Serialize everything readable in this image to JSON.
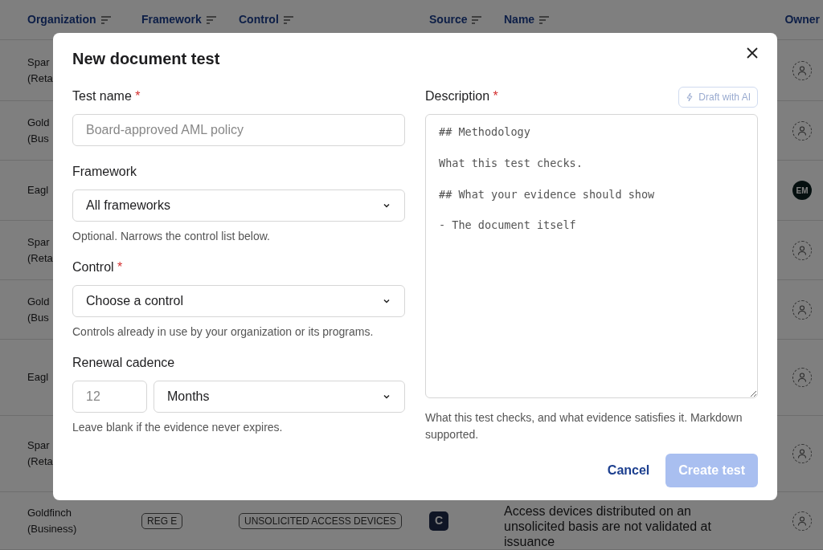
{
  "table": {
    "columns": [
      {
        "label": "Organization",
        "sortable": true
      },
      {
        "label": "Framework",
        "sortable": true
      },
      {
        "label": "Control",
        "sortable": true
      },
      {
        "label": "Source",
        "sortable": true
      },
      {
        "label": "Name",
        "sortable": true
      },
      {
        "label": "Owner",
        "sortable": false
      }
    ],
    "rows": [
      {
        "organization": [
          "Spar",
          "(Reta"
        ],
        "owner": {
          "kind": "unassigned"
        }
      },
      {
        "organization": [
          "Gold",
          "(Bus"
        ],
        "owner": {
          "kind": "unassigned"
        }
      },
      {
        "organization": [
          "Eagl"
        ],
        "owner": {
          "kind": "initials",
          "initials": "EM"
        }
      },
      {
        "organization": [
          "Spar",
          "(Reta"
        ],
        "owner": {
          "kind": "unassigned"
        }
      },
      {
        "organization": [
          "Gold",
          "(Bus"
        ],
        "owner": {
          "kind": "unassigned"
        }
      },
      {
        "organization": [
          "Eagl"
        ],
        "owner": {
          "kind": "unassigned"
        }
      },
      {
        "organization": [
          "Spar",
          "(Reta"
        ],
        "owner": {
          "kind": "unassigned"
        }
      },
      {
        "organization": [
          "Goldfinch",
          "(Business)"
        ],
        "framework": "REG E",
        "control": "UNSOLICITED ACCESS DEVICES",
        "source": "C",
        "name": "Access devices distributed on an unsolicited basis are not validated at issuance",
        "owner": {
          "kind": "unassigned"
        }
      }
    ]
  },
  "modal": {
    "title": "New document test",
    "required_marker": "*",
    "left_fields": [
      {
        "kind": "text",
        "label": "Test name",
        "required": true,
        "placeholder": "Board-approved AML policy"
      },
      {
        "kind": "select",
        "label": "Framework",
        "required": false,
        "value": "All frameworks",
        "help": "Optional. Narrows the control list below."
      },
      {
        "kind": "select",
        "label": "Control",
        "required": true,
        "value": "Choose a control",
        "help": "Controls already in use by your organization or its programs."
      },
      {
        "kind": "cadence",
        "label": "Renewal cadence",
        "required": false,
        "placeholder": "12",
        "value": "Months",
        "help": "Leave blank if the evidence never expires."
      }
    ],
    "description": {
      "label": "Description",
      "required": true,
      "ai_button": "Draft with AI",
      "ai_disabled": true,
      "value": "## Methodology\n\nWhat this test checks.\n\n## What your evidence should show\n\n- The document itself",
      "help": "What this test checks, and what evidence satisfies it. Markdown supported."
    },
    "buttons": [
      {
        "kind": "link",
        "label": "Cancel",
        "disabled": false
      },
      {
        "kind": "primary",
        "label": "Create test",
        "disabled": true
      }
    ]
  }
}
